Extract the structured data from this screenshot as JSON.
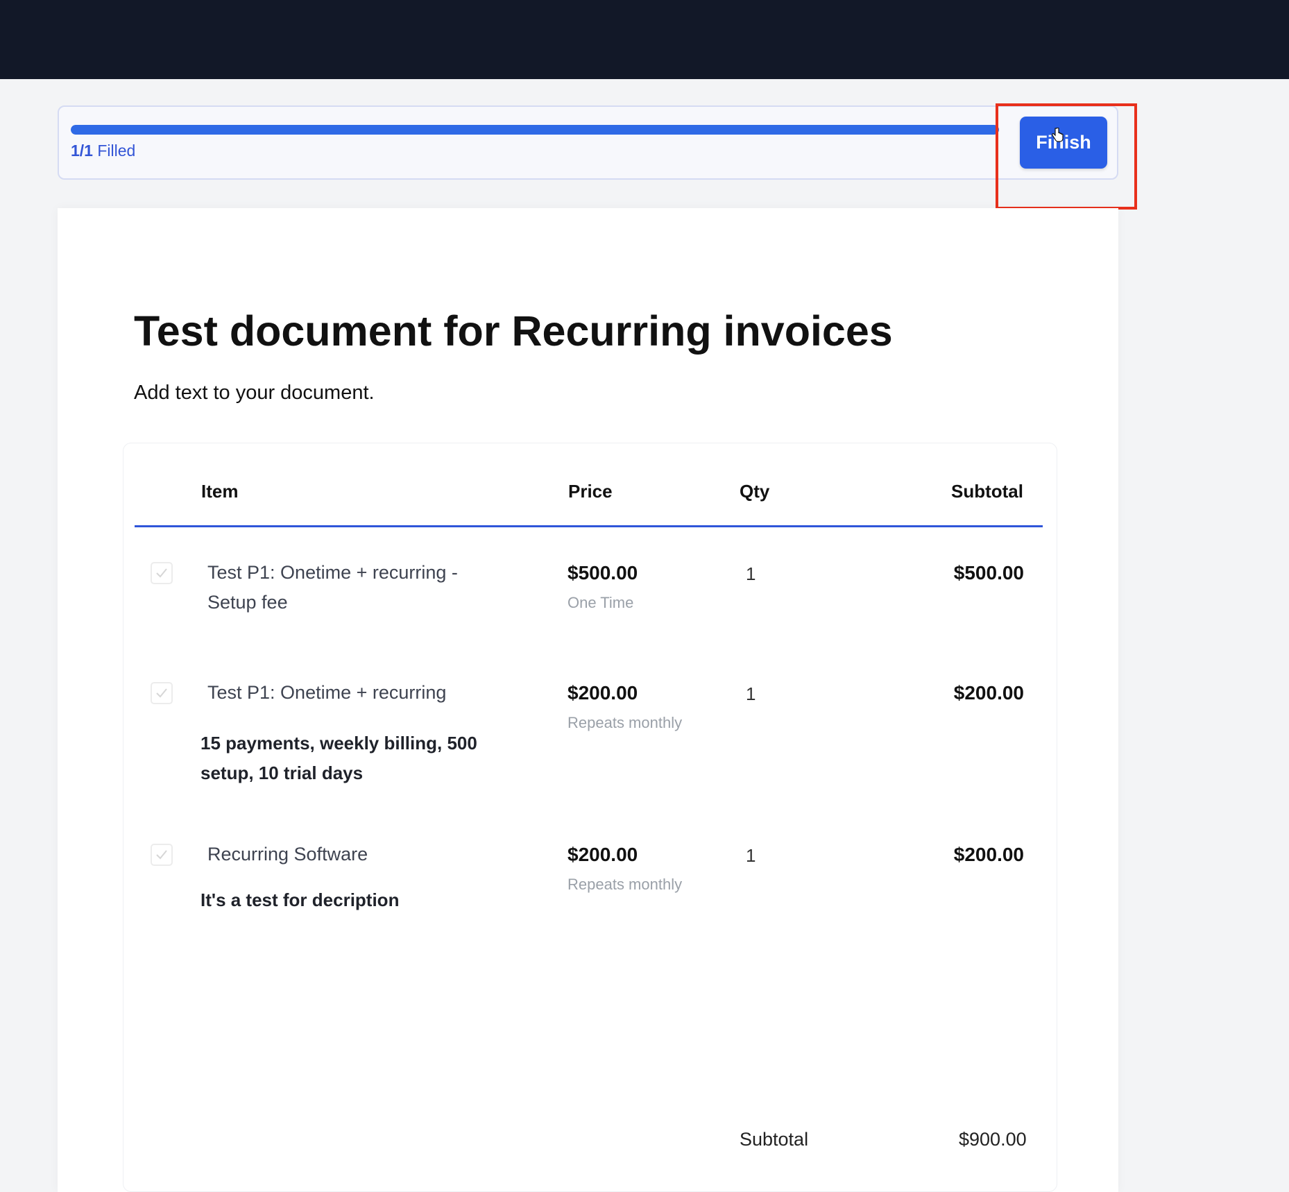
{
  "progress": {
    "count": "1/1",
    "label": "Filled",
    "fraction": 1.0,
    "finish_label": "Finish"
  },
  "document": {
    "title": "Test document for Recurring invoices",
    "subtitle": "Add text to your document."
  },
  "table": {
    "headers": {
      "item": "Item",
      "price": "Price",
      "qty": "Qty",
      "subtotal": "Subtotal"
    },
    "rows": [
      {
        "name": "Test P1: Onetime + recurring - Setup fee",
        "description": "",
        "price": "$500.00",
        "billing": "One Time",
        "qty": "1",
        "subtotal": "$500.00"
      },
      {
        "name": "Test P1: Onetime + recurring",
        "description": "15 payments, weekly billing, 500 setup, 10 trial days",
        "price": "$200.00",
        "billing": "Repeats monthly",
        "qty": "1",
        "subtotal": "$200.00"
      },
      {
        "name": "Recurring Software",
        "description": "It's a test for decription",
        "price": "$200.00",
        "billing": "Repeats monthly",
        "qty": "1",
        "subtotal": "$200.00"
      }
    ],
    "summary": {
      "label": "Subtotal",
      "value": "$900.00"
    }
  },
  "colors": {
    "topbar": "#121828",
    "accent": "#2a5fe6",
    "highlight": "#e8301c"
  },
  "icons": {
    "row_checkbox": "check-icon",
    "cursor": "hand-pointer-icon"
  }
}
